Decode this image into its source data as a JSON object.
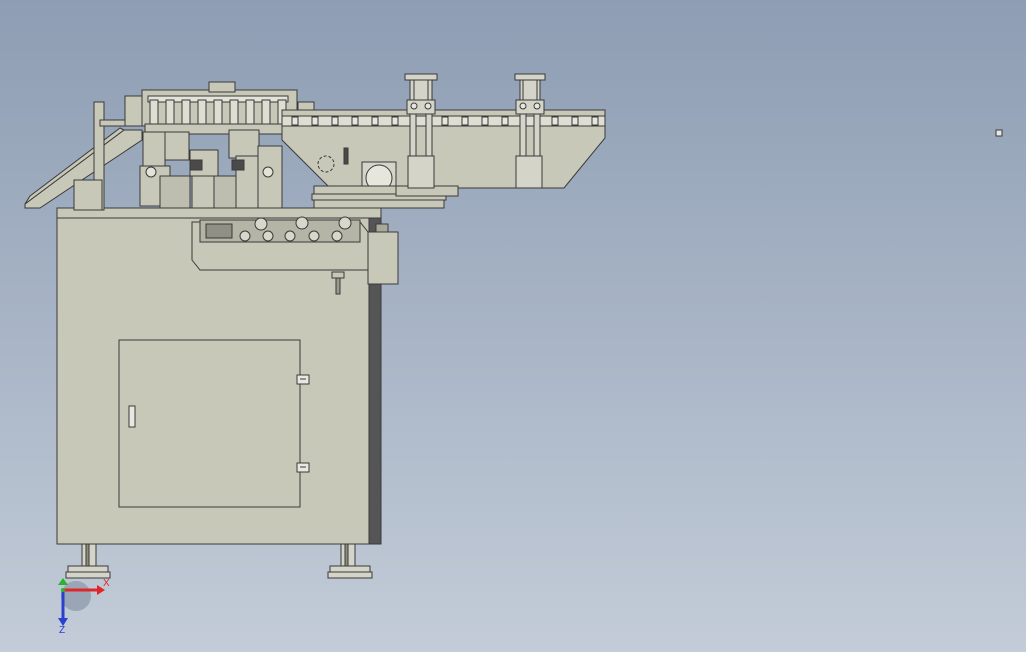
{
  "viewport": {
    "model": "labeling-machine-assembly",
    "background_top": "#8e9db3",
    "background_bottom": "#c3ccd8"
  },
  "colors": {
    "machine_body": "#c8c8b8",
    "machine_edge": "#3a3a3a",
    "machine_shade": "#a9a99a",
    "side_panel": "#555555"
  },
  "triad": {
    "x_label": "X",
    "z_label": "Z",
    "x_color": "#e0262a",
    "y_color": "#2bb42b",
    "z_color": "#2b3fd0"
  },
  "view_marker": {
    "icon": "small-square-marker-icon"
  }
}
